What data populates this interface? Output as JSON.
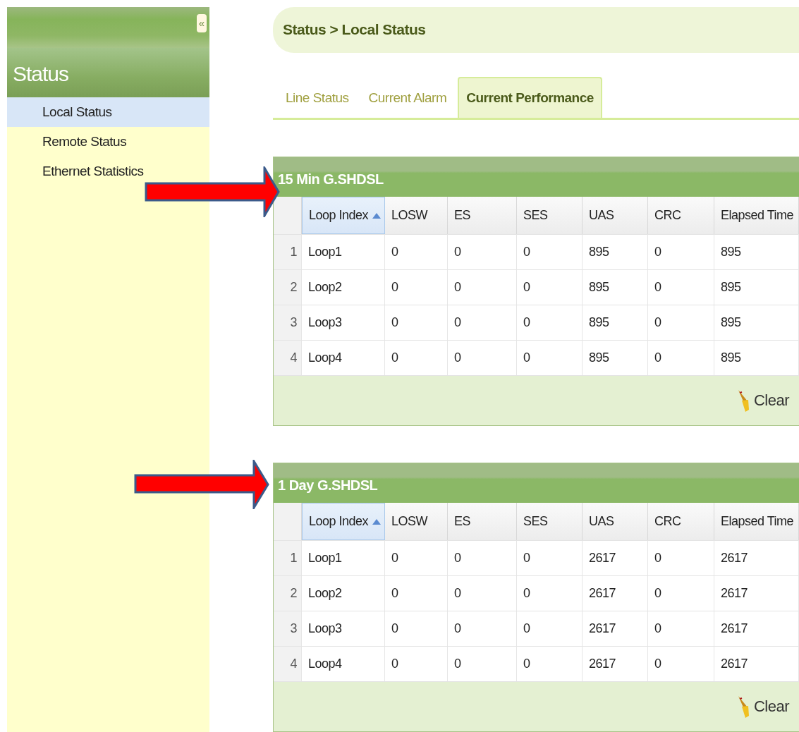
{
  "sidebar": {
    "collapse": "«",
    "title": "Status",
    "items": [
      {
        "label": "Local Status",
        "selected": true
      },
      {
        "label": "Remote Status",
        "selected": false
      },
      {
        "label": "Ethernet Statistics",
        "selected": false
      }
    ]
  },
  "breadcrumb": "Status > Local Status",
  "tabs": [
    {
      "label": "Line Status",
      "selected": false
    },
    {
      "label": "Current Alarm",
      "selected": false
    },
    {
      "label": "Current Performance",
      "selected": true
    }
  ],
  "panels": [
    {
      "title": "15 Min G.SHDSL",
      "columns": [
        {
          "label": "Loop Index",
          "sorted": true
        },
        {
          "label": "LOSW",
          "sorted": false
        },
        {
          "label": "ES",
          "sorted": false
        },
        {
          "label": "SES",
          "sorted": false
        },
        {
          "label": "UAS",
          "sorted": false
        },
        {
          "label": "CRC",
          "sorted": false
        },
        {
          "label": "Elapsed Time",
          "sorted": false
        }
      ],
      "rows": [
        {
          "number": "1",
          "cells": [
            "Loop1",
            "0",
            "0",
            "0",
            "895",
            "0",
            "895"
          ]
        },
        {
          "number": "2",
          "cells": [
            "Loop2",
            "0",
            "0",
            "0",
            "895",
            "0",
            "895"
          ]
        },
        {
          "number": "3",
          "cells": [
            "Loop3",
            "0",
            "0",
            "0",
            "895",
            "0",
            "895"
          ]
        },
        {
          "number": "4",
          "cells": [
            "Loop4",
            "0",
            "0",
            "0",
            "895",
            "0",
            "895"
          ]
        }
      ],
      "clear": "Clear"
    },
    {
      "title": "1 Day G.SHDSL",
      "columns": [
        {
          "label": "Loop Index",
          "sorted": true
        },
        {
          "label": "LOSW",
          "sorted": false
        },
        {
          "label": "ES",
          "sorted": false
        },
        {
          "label": "SES",
          "sorted": false
        },
        {
          "label": "UAS",
          "sorted": false
        },
        {
          "label": "CRC",
          "sorted": false
        },
        {
          "label": "Elapsed Time",
          "sorted": false
        }
      ],
      "rows": [
        {
          "number": "1",
          "cells": [
            "Loop1",
            "0",
            "0",
            "0",
            "2617",
            "0",
            "2617"
          ]
        },
        {
          "number": "2",
          "cells": [
            "Loop2",
            "0",
            "0",
            "0",
            "2617",
            "0",
            "2617"
          ]
        },
        {
          "number": "3",
          "cells": [
            "Loop3",
            "0",
            "0",
            "0",
            "2617",
            "0",
            "2617"
          ]
        },
        {
          "number": "4",
          "cells": [
            "Loop4",
            "0",
            "0",
            "0",
            "2617",
            "0",
            "2617"
          ]
        }
      ],
      "clear": "Clear"
    }
  ]
}
